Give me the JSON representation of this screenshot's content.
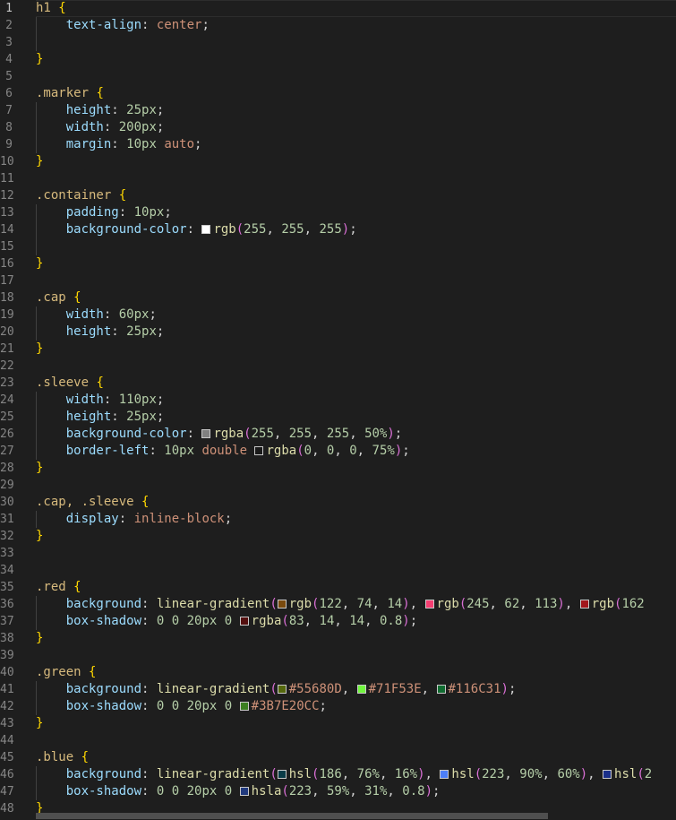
{
  "editor": {
    "active_line": 1,
    "lines": [
      [
        {
          "t": "h1 ",
          "c": "selector"
        },
        {
          "t": "{",
          "c": "brace"
        }
      ],
      [
        {
          "t": "    "
        },
        {
          "t": "text-align",
          "c": "prop"
        },
        {
          "t": ": ",
          "c": "punct"
        },
        {
          "t": "center",
          "c": "value"
        },
        {
          "t": ";",
          "c": "punct"
        }
      ],
      [
        {
          "t": "    "
        }
      ],
      [
        {
          "t": "}",
          "c": "brace"
        }
      ],
      [],
      [
        {
          "t": ".marker ",
          "c": "selector"
        },
        {
          "t": "{",
          "c": "brace"
        }
      ],
      [
        {
          "t": "    "
        },
        {
          "t": "height",
          "c": "prop"
        },
        {
          "t": ": ",
          "c": "punct"
        },
        {
          "t": "25px",
          "c": "num"
        },
        {
          "t": ";",
          "c": "punct"
        }
      ],
      [
        {
          "t": "    "
        },
        {
          "t": "width",
          "c": "prop"
        },
        {
          "t": ": ",
          "c": "punct"
        },
        {
          "t": "200px",
          "c": "num"
        },
        {
          "t": ";",
          "c": "punct"
        }
      ],
      [
        {
          "t": "    "
        },
        {
          "t": "margin",
          "c": "prop"
        },
        {
          "t": ": ",
          "c": "punct"
        },
        {
          "t": "10px",
          "c": "num"
        },
        {
          "t": " "
        },
        {
          "t": "auto",
          "c": "value"
        },
        {
          "t": ";",
          "c": "punct"
        }
      ],
      [
        {
          "t": "}",
          "c": "brace"
        }
      ],
      [],
      [
        {
          "t": ".container ",
          "c": "selector"
        },
        {
          "t": "{",
          "c": "brace"
        }
      ],
      [
        {
          "t": "    "
        },
        {
          "t": "padding",
          "c": "prop"
        },
        {
          "t": ": ",
          "c": "punct"
        },
        {
          "t": "10px",
          "c": "num"
        },
        {
          "t": ";",
          "c": "punct"
        }
      ],
      [
        {
          "t": "    "
        },
        {
          "t": "background-color",
          "c": "prop"
        },
        {
          "t": ": ",
          "c": "punct"
        },
        {
          "s": "#ffffff"
        },
        {
          "t": "rgb",
          "c": "fn"
        },
        {
          "t": "(",
          "c": "paren"
        },
        {
          "t": "255",
          "c": "num"
        },
        {
          "t": ", ",
          "c": "punct"
        },
        {
          "t": "255",
          "c": "num"
        },
        {
          "t": ", ",
          "c": "punct"
        },
        {
          "t": "255",
          "c": "num"
        },
        {
          "t": ")",
          "c": "paren"
        },
        {
          "t": ";",
          "c": "punct"
        }
      ],
      [
        {
          "t": "    "
        }
      ],
      [
        {
          "t": "}",
          "c": "brace"
        }
      ],
      [],
      [
        {
          "t": ".cap ",
          "c": "selector"
        },
        {
          "t": "{",
          "c": "brace"
        }
      ],
      [
        {
          "t": "    "
        },
        {
          "t": "width",
          "c": "prop"
        },
        {
          "t": ": ",
          "c": "punct"
        },
        {
          "t": "60px",
          "c": "num"
        },
        {
          "t": ";",
          "c": "punct"
        }
      ],
      [
        {
          "t": "    "
        },
        {
          "t": "height",
          "c": "prop"
        },
        {
          "t": ": ",
          "c": "punct"
        },
        {
          "t": "25px",
          "c": "num"
        },
        {
          "t": ";",
          "c": "punct"
        }
      ],
      [
        {
          "t": "}",
          "c": "brace"
        }
      ],
      [],
      [
        {
          "t": ".sleeve ",
          "c": "selector"
        },
        {
          "t": "{",
          "c": "brace"
        }
      ],
      [
        {
          "t": "    "
        },
        {
          "t": "width",
          "c": "prop"
        },
        {
          "t": ": ",
          "c": "punct"
        },
        {
          "t": "110px",
          "c": "num"
        },
        {
          "t": ";",
          "c": "punct"
        }
      ],
      [
        {
          "t": "    "
        },
        {
          "t": "height",
          "c": "prop"
        },
        {
          "t": ": ",
          "c": "punct"
        },
        {
          "t": "25px",
          "c": "num"
        },
        {
          "t": ";",
          "c": "punct"
        }
      ],
      [
        {
          "t": "    "
        },
        {
          "t": "background-color",
          "c": "prop"
        },
        {
          "t": ": ",
          "c": "punct"
        },
        {
          "s": "#808080"
        },
        {
          "t": "rgba",
          "c": "fn"
        },
        {
          "t": "(",
          "c": "paren"
        },
        {
          "t": "255",
          "c": "num"
        },
        {
          "t": ", ",
          "c": "punct"
        },
        {
          "t": "255",
          "c": "num"
        },
        {
          "t": ", ",
          "c": "punct"
        },
        {
          "t": "255",
          "c": "num"
        },
        {
          "t": ", ",
          "c": "punct"
        },
        {
          "t": "50%",
          "c": "num"
        },
        {
          "t": ")",
          "c": "paren"
        },
        {
          "t": ";",
          "c": "punct"
        }
      ],
      [
        {
          "t": "    "
        },
        {
          "t": "border-left",
          "c": "prop"
        },
        {
          "t": ": ",
          "c": "punct"
        },
        {
          "t": "10px",
          "c": "num"
        },
        {
          "t": " "
        },
        {
          "t": "double",
          "c": "value"
        },
        {
          "t": " "
        },
        {
          "s": "#1a1a1a"
        },
        {
          "t": "rgba",
          "c": "fn"
        },
        {
          "t": "(",
          "c": "paren"
        },
        {
          "t": "0",
          "c": "num"
        },
        {
          "t": ", ",
          "c": "punct"
        },
        {
          "t": "0",
          "c": "num"
        },
        {
          "t": ", ",
          "c": "punct"
        },
        {
          "t": "0",
          "c": "num"
        },
        {
          "t": ", ",
          "c": "punct"
        },
        {
          "t": "75%",
          "c": "num"
        },
        {
          "t": ")",
          "c": "paren"
        },
        {
          "t": ";",
          "c": "punct"
        }
      ],
      [
        {
          "t": "}",
          "c": "brace"
        }
      ],
      [],
      [
        {
          "t": ".cap, .sleeve ",
          "c": "selector"
        },
        {
          "t": "{",
          "c": "brace"
        }
      ],
      [
        {
          "t": "    "
        },
        {
          "t": "display",
          "c": "prop"
        },
        {
          "t": ": ",
          "c": "punct"
        },
        {
          "t": "inline-block",
          "c": "value"
        },
        {
          "t": ";",
          "c": "punct"
        }
      ],
      [
        {
          "t": "}",
          "c": "brace"
        }
      ],
      [],
      [],
      [
        {
          "t": ".red ",
          "c": "selector"
        },
        {
          "t": "{",
          "c": "brace"
        }
      ],
      [
        {
          "t": "    "
        },
        {
          "t": "background",
          "c": "prop"
        },
        {
          "t": ": ",
          "c": "punct"
        },
        {
          "t": "linear-gradient",
          "c": "fn"
        },
        {
          "t": "(",
          "c": "paren"
        },
        {
          "s": "#7a4a0e"
        },
        {
          "t": "rgb",
          "c": "fn"
        },
        {
          "t": "(",
          "c": "paren"
        },
        {
          "t": "122",
          "c": "num"
        },
        {
          "t": ", ",
          "c": "punct"
        },
        {
          "t": "74",
          "c": "num"
        },
        {
          "t": ", ",
          "c": "punct"
        },
        {
          "t": "14",
          "c": "num"
        },
        {
          "t": ")",
          "c": "paren"
        },
        {
          "t": ", ",
          "c": "punct"
        },
        {
          "s": "#f53e71"
        },
        {
          "t": "rgb",
          "c": "fn"
        },
        {
          "t": "(",
          "c": "paren"
        },
        {
          "t": "245",
          "c": "num"
        },
        {
          "t": ", ",
          "c": "punct"
        },
        {
          "t": "62",
          "c": "num"
        },
        {
          "t": ", ",
          "c": "punct"
        },
        {
          "t": "113",
          "c": "num"
        },
        {
          "t": ")",
          "c": "paren"
        },
        {
          "t": ", ",
          "c": "punct"
        },
        {
          "s": "#a2161c"
        },
        {
          "t": "rgb",
          "c": "fn"
        },
        {
          "t": "(",
          "c": "paren"
        },
        {
          "t": "162",
          "c": "num"
        }
      ],
      [
        {
          "t": "    "
        },
        {
          "t": "box-shadow",
          "c": "prop"
        },
        {
          "t": ": ",
          "c": "punct"
        },
        {
          "t": "0",
          "c": "num"
        },
        {
          "t": " "
        },
        {
          "t": "0",
          "c": "num"
        },
        {
          "t": " "
        },
        {
          "t": "20px",
          "c": "num"
        },
        {
          "t": " "
        },
        {
          "t": "0",
          "c": "num"
        },
        {
          "t": " "
        },
        {
          "s": "#530e0e"
        },
        {
          "t": "rgba",
          "c": "fn"
        },
        {
          "t": "(",
          "c": "paren"
        },
        {
          "t": "83",
          "c": "num"
        },
        {
          "t": ", ",
          "c": "punct"
        },
        {
          "t": "14",
          "c": "num"
        },
        {
          "t": ", ",
          "c": "punct"
        },
        {
          "t": "14",
          "c": "num"
        },
        {
          "t": ", ",
          "c": "punct"
        },
        {
          "t": "0.8",
          "c": "num"
        },
        {
          "t": ")",
          "c": "paren"
        },
        {
          "t": ";",
          "c": "punct"
        }
      ],
      [
        {
          "t": "}",
          "c": "brace"
        }
      ],
      [],
      [
        {
          "t": ".green ",
          "c": "selector"
        },
        {
          "t": "{",
          "c": "brace"
        }
      ],
      [
        {
          "t": "    "
        },
        {
          "t": "background",
          "c": "prop"
        },
        {
          "t": ": ",
          "c": "punct"
        },
        {
          "t": "linear-gradient",
          "c": "fn"
        },
        {
          "t": "(",
          "c": "paren"
        },
        {
          "s": "#55680D"
        },
        {
          "t": "#55680D",
          "c": "value"
        },
        {
          "t": ", ",
          "c": "punct"
        },
        {
          "s": "#71F53E"
        },
        {
          "t": "#71F53E",
          "c": "value"
        },
        {
          "t": ", ",
          "c": "punct"
        },
        {
          "s": "#116C31"
        },
        {
          "t": "#116C31",
          "c": "value"
        },
        {
          "t": ")",
          "c": "paren"
        },
        {
          "t": ";",
          "c": "punct"
        }
      ],
      [
        {
          "t": "    "
        },
        {
          "t": "box-shadow",
          "c": "prop"
        },
        {
          "t": ": ",
          "c": "punct"
        },
        {
          "t": "0",
          "c": "num"
        },
        {
          "t": " "
        },
        {
          "t": "0",
          "c": "num"
        },
        {
          "t": " "
        },
        {
          "t": "20px",
          "c": "num"
        },
        {
          "t": " "
        },
        {
          "t": "0",
          "c": "num"
        },
        {
          "t": " "
        },
        {
          "s": "#3B7E20"
        },
        {
          "t": "#3B7E20CC",
          "c": "value"
        },
        {
          "t": ";",
          "c": "punct"
        }
      ],
      [
        {
          "t": "}",
          "c": "brace"
        }
      ],
      [],
      [
        {
          "t": ".blue ",
          "c": "selector"
        },
        {
          "t": "{",
          "c": "brace"
        }
      ],
      [
        {
          "t": "    "
        },
        {
          "t": "background",
          "c": "prop"
        },
        {
          "t": ": ",
          "c": "punct"
        },
        {
          "t": "linear-gradient",
          "c": "fn"
        },
        {
          "t": "(",
          "c": "paren"
        },
        {
          "s": "#0a3b47"
        },
        {
          "t": "hsl",
          "c": "fn"
        },
        {
          "t": "(",
          "c": "paren"
        },
        {
          "t": "186",
          "c": "num"
        },
        {
          "t": ", ",
          "c": "punct"
        },
        {
          "t": "76%",
          "c": "num"
        },
        {
          "t": ", ",
          "c": "punct"
        },
        {
          "t": "16%",
          "c": "num"
        },
        {
          "t": ")",
          "c": "paren"
        },
        {
          "t": ", ",
          "c": "punct"
        },
        {
          "s": "#4d7ef7"
        },
        {
          "t": "hsl",
          "c": "fn"
        },
        {
          "t": "(",
          "c": "paren"
        },
        {
          "t": "223",
          "c": "num"
        },
        {
          "t": ", ",
          "c": "punct"
        },
        {
          "t": "90%",
          "c": "num"
        },
        {
          "t": ", ",
          "c": "punct"
        },
        {
          "t": "60%",
          "c": "num"
        },
        {
          "t": ")",
          "c": "paren"
        },
        {
          "t": ", ",
          "c": "punct"
        },
        {
          "s": "#1a2f8a"
        },
        {
          "t": "hsl",
          "c": "fn"
        },
        {
          "t": "(",
          "c": "paren"
        },
        {
          "t": "2",
          "c": "num"
        }
      ],
      [
        {
          "t": "    "
        },
        {
          "t": "box-shadow",
          "c": "prop"
        },
        {
          "t": ": ",
          "c": "punct"
        },
        {
          "t": "0",
          "c": "num"
        },
        {
          "t": " "
        },
        {
          "t": "0",
          "c": "num"
        },
        {
          "t": " "
        },
        {
          "t": "20px",
          "c": "num"
        },
        {
          "t": " "
        },
        {
          "t": "0",
          "c": "num"
        },
        {
          "t": " "
        },
        {
          "s": "#213a7e"
        },
        {
          "t": "hsla",
          "c": "fn"
        },
        {
          "t": "(",
          "c": "paren"
        },
        {
          "t": "223",
          "c": "num"
        },
        {
          "t": ", ",
          "c": "punct"
        },
        {
          "t": "59%",
          "c": "num"
        },
        {
          "t": ", ",
          "c": "punct"
        },
        {
          "t": "31%",
          "c": "num"
        },
        {
          "t": ", ",
          "c": "punct"
        },
        {
          "t": "0.8",
          "c": "num"
        },
        {
          "t": ")",
          "c": "paren"
        },
        {
          "t": ";",
          "c": "punct"
        }
      ],
      [
        {
          "t": "}",
          "c": "brace"
        }
      ]
    ]
  }
}
